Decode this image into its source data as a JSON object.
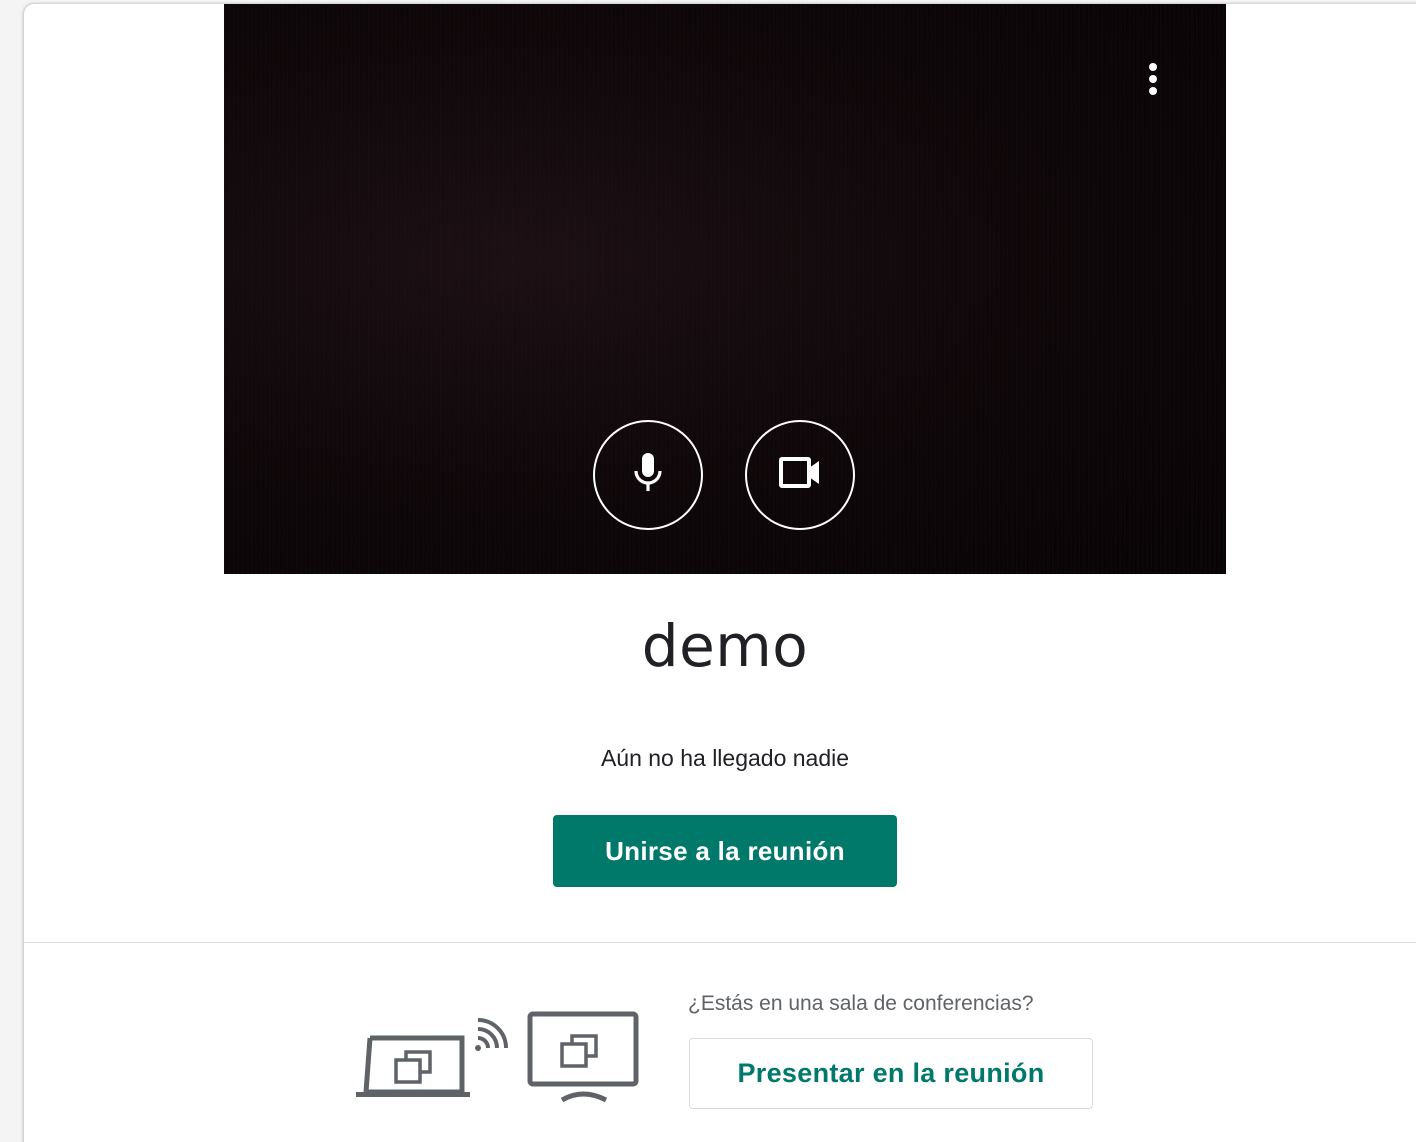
{
  "preview": {
    "more_icon": "more-vert-icon",
    "mic_icon": "microphone-icon",
    "camera_icon": "videocam-icon"
  },
  "meeting": {
    "name": "demo",
    "status": "Aún no ha llegado nadie",
    "join_label": "Unirse a la reunión"
  },
  "conference_room": {
    "question": "¿Estás en una sala de conferencias?",
    "present_label": "Presentar en la reunión",
    "illustration_icons": [
      "laptop-icon",
      "cast-signal-icon",
      "tv-display-icon"
    ]
  },
  "colors": {
    "accent": "#00796b",
    "text_primary": "#202124",
    "text_secondary": "#5f6368",
    "divider": "#dadce0"
  }
}
